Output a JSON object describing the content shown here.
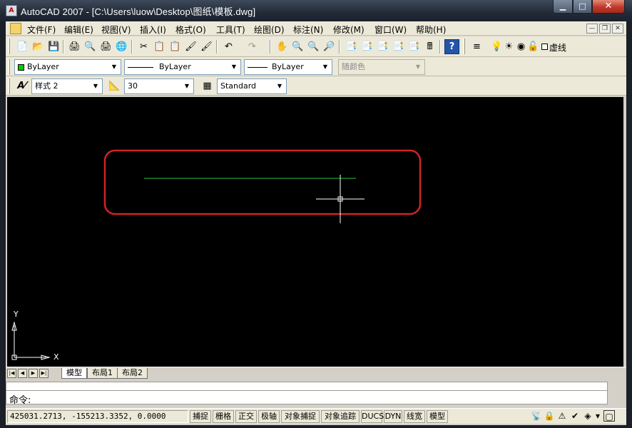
{
  "window": {
    "title": "AutoCAD 2007 - [C:\\Users\\luow\\Desktop\\图纸\\模板.dwg]",
    "min": "▁",
    "max": "□",
    "close": "✕"
  },
  "menubar": {
    "items": [
      "文件(F)",
      "编辑(E)",
      "视图(V)",
      "插入(I)",
      "格式(O)",
      "工具(T)",
      "绘图(D)",
      "标注(N)",
      "修改(M)",
      "窗口(W)",
      "帮助(H)"
    ],
    "mdi_min": "—",
    "mdi_restore": "❐",
    "mdi_close": "✕"
  },
  "standard_toolbar": {
    "icons": [
      "📄",
      "📂",
      "💾",
      "🖨",
      "🔍",
      "🖨",
      "🌐",
      "✂",
      "📋",
      "📋",
      "🖌",
      "🖌",
      "↶",
      "↷",
      "✋",
      "🔍",
      "🔍",
      "🔎",
      "📑",
      "📑",
      "📑",
      "📑",
      "📑",
      "🖩",
      "?"
    ],
    "layer": "虚线"
  },
  "properties": {
    "color": "ByLayer",
    "color_swatch": "#00cc00",
    "linetype": "ByLayer",
    "lineweight": "ByLayer",
    "plotstyle": "随颜色"
  },
  "styles": {
    "text_style": "样式 2",
    "dim_scale": "30",
    "table_style": "Standard"
  },
  "drawing": {
    "line_color": "#22c93a",
    "highlight_color": "#d1222a",
    "ucs_x": "X",
    "ucs_y": "Y"
  },
  "layout_tabs": [
    "模型",
    "布局1",
    "布局2"
  ],
  "command": {
    "prompt": "命令:",
    "value": ""
  },
  "statusbar": {
    "coords": "425031.2713, -155213.3352, 0.0000",
    "toggles": [
      "捕捉",
      "栅格",
      "正交",
      "极轴",
      "对象捕捉",
      "对象追踪",
      "DUCS",
      "DYN",
      "线宽",
      "模型"
    ]
  }
}
